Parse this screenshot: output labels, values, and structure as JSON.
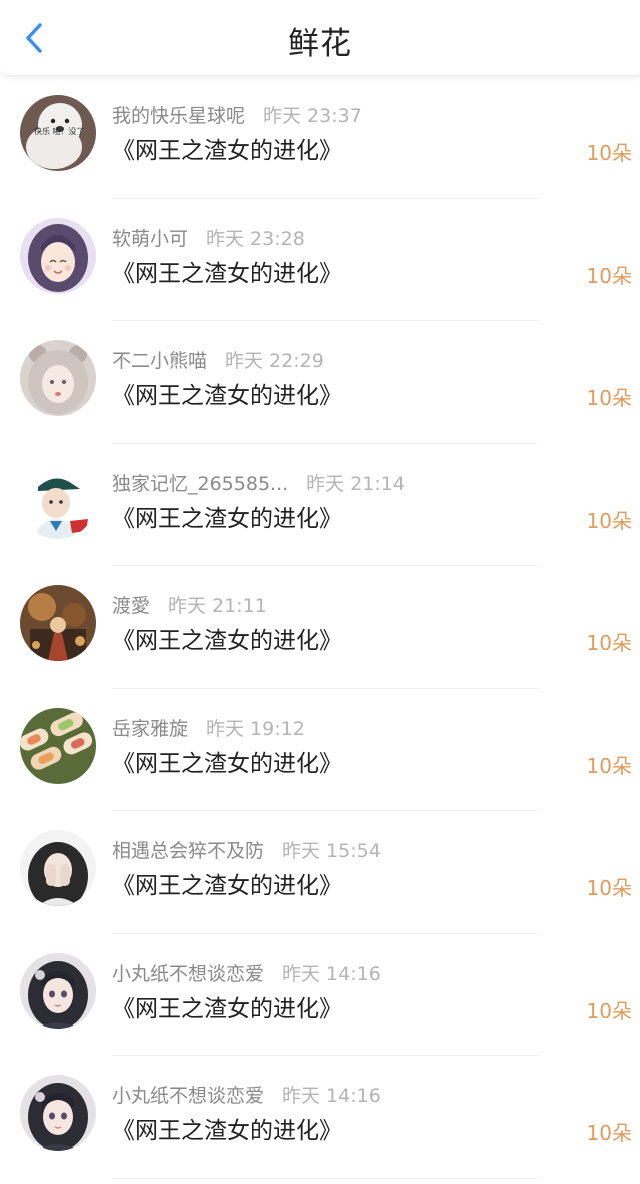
{
  "header": {
    "title": "鲜花",
    "back_icon": "chevron-left-icon",
    "accent_color": "#3a8ff0"
  },
  "flower_color": "#e39a5a",
  "rows": [
    {
      "name": "我的快乐星球呢",
      "time": "昨天 23:37",
      "book": "《网王之渣女的进化》",
      "count": "10朵",
      "avatar_text": "快乐 啪！没了"
    },
    {
      "name": "软萌小可",
      "time": "昨天 23:28",
      "book": "《网王之渣女的进化》",
      "count": "10朵"
    },
    {
      "name": "不二小熊喵",
      "time": "昨天 22:29",
      "book": "《网王之渣女的进化》",
      "count": "10朵"
    },
    {
      "name": "独家记忆_265585...",
      "time": "昨天 21:14",
      "book": "《网王之渣女的进化》",
      "count": "10朵"
    },
    {
      "name": "渡愛",
      "time": "昨天 21:11",
      "book": "《网王之渣女的进化》",
      "count": "10朵"
    },
    {
      "name": "岳家雅旋",
      "time": "昨天 19:12",
      "book": "《网王之渣女的进化》",
      "count": "10朵"
    },
    {
      "name": "相遇总会猝不及防",
      "time": "昨天 15:54",
      "book": "《网王之渣女的进化》",
      "count": "10朵"
    },
    {
      "name": "小丸纸不想谈恋爱",
      "time": "昨天 14:16",
      "book": "《网王之渣女的进化》",
      "count": "10朵"
    },
    {
      "name": "小丸纸不想谈恋爱",
      "time": "昨天 14:16",
      "book": "《网王之渣女的进化》",
      "count": "10朵"
    }
  ]
}
